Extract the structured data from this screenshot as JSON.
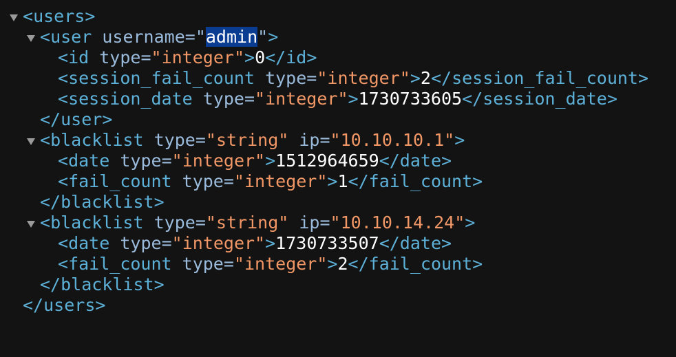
{
  "xml": {
    "root_tag": "users",
    "user": {
      "tag": "user",
      "attr_name": "username",
      "attr_value": "admin",
      "fields": [
        {
          "tag": "id",
          "type_attr": "type",
          "type_value": "integer",
          "value": "0"
        },
        {
          "tag": "session_fail_count",
          "type_attr": "type",
          "type_value": "integer",
          "value": "2"
        },
        {
          "tag": "session_date",
          "type_attr": "type",
          "type_value": "integer",
          "value": "1730733605"
        }
      ]
    },
    "blacklists": [
      {
        "tag": "blacklist",
        "type_attr": "type",
        "type_value": "string",
        "ip_attr": "ip",
        "ip_value": "10.10.10.1",
        "fields": [
          {
            "tag": "date",
            "type_attr": "type",
            "type_value": "integer",
            "value": "1512964659"
          },
          {
            "tag": "fail_count",
            "type_attr": "type",
            "type_value": "integer",
            "value": "1"
          }
        ]
      },
      {
        "tag": "blacklist",
        "type_attr": "type",
        "type_value": "string",
        "ip_attr": "ip",
        "ip_value": "10.10.14.24",
        "fields": [
          {
            "tag": "date",
            "type_attr": "type",
            "type_value": "integer",
            "value": "1730733507"
          },
          {
            "tag": "fail_count",
            "type_attr": "type",
            "type_value": "integer",
            "value": "2"
          }
        ]
      }
    ]
  },
  "colors": {
    "background": "#131313",
    "tag": "#5db0d7",
    "attribute_name": "#9bbbdc",
    "attribute_value": "#f29766",
    "text_content": "#ffffff",
    "selection": "#0a3d91",
    "toggle_arrow": "#9a9a9a"
  },
  "icons": {
    "toggle": "triangle-down-icon"
  }
}
